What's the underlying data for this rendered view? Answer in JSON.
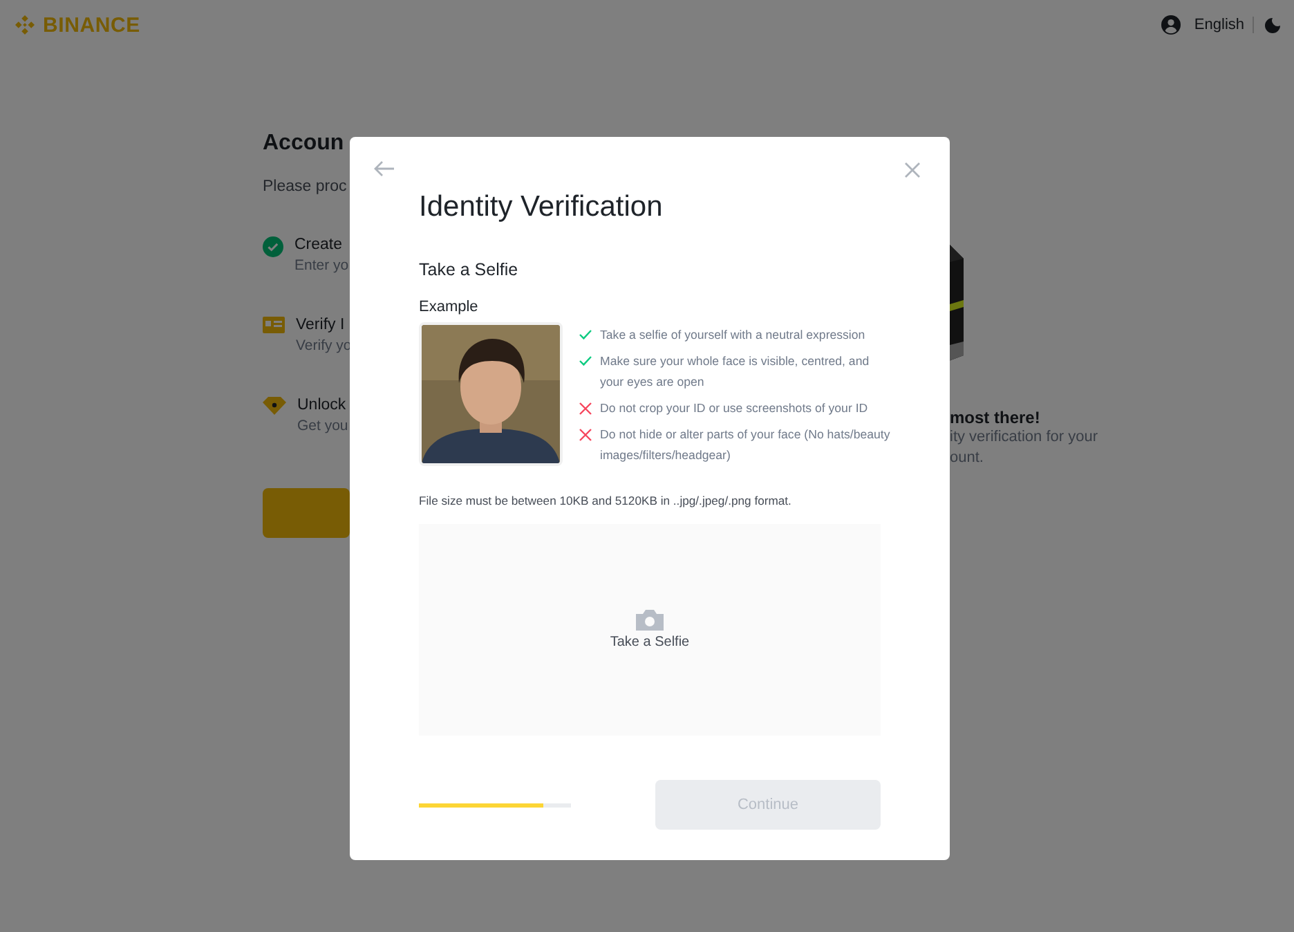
{
  "header": {
    "brand": "BINANCE",
    "language": "English"
  },
  "background_page": {
    "title": "Accoun",
    "subtitle": "Please proc",
    "steps": [
      {
        "kind": "done",
        "title": "Create",
        "description": "Enter yo"
      },
      {
        "kind": "id",
        "title": "Verify I",
        "description": "Verify yo"
      },
      {
        "kind": "unlock",
        "title": "Unlock",
        "description": "Get you"
      }
    ],
    "side_title": "most there!",
    "side_text": [
      "ity verification for your",
      "ount."
    ]
  },
  "modal": {
    "title": "Identity Verification",
    "section": "Take a Selfie",
    "example_label": "Example",
    "rules": [
      {
        "allowed": true,
        "text": "Take a selfie of yourself with a neutral expression"
      },
      {
        "allowed": true,
        "text": "Make sure your whole face is visible, centred, and your eyes are open"
      },
      {
        "allowed": false,
        "text": "Do not crop your ID or use screenshots of your ID"
      },
      {
        "allowed": false,
        "text": "Do not hide or alter parts of your face (No hats/beauty images/filters/headgear)"
      }
    ],
    "file_note": "File size must be between 10KB and 5120KB in ..jpg/.jpeg/.png format.",
    "upload": {
      "label": "Take a Selfie"
    },
    "progress": {
      "level": 0.82
    },
    "continue": {
      "label": "Continue",
      "disabled": true
    }
  }
}
